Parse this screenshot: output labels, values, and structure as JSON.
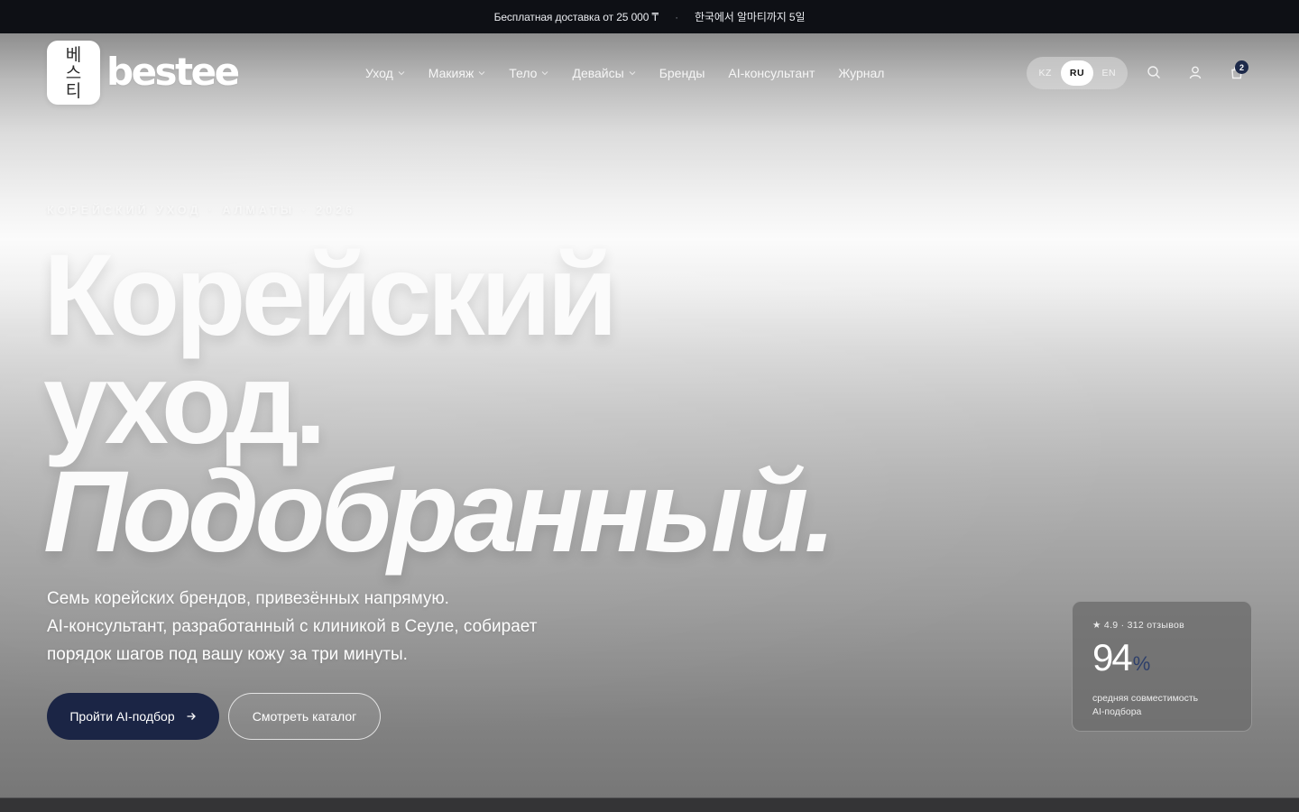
{
  "announcement": {
    "left": "Бесплатная доставка от 25 000 ₸",
    "separator": "·",
    "right": "한국에서 알마티까지 5일"
  },
  "brand": {
    "logo_mark_lines": [
      "베",
      "스",
      "티"
    ],
    "logo_word": "bestee"
  },
  "nav": {
    "items": [
      {
        "label": "Уход",
        "has_dropdown": true
      },
      {
        "label": "Макияж",
        "has_dropdown": true
      },
      {
        "label": "Тело",
        "has_dropdown": true
      },
      {
        "label": "Девайсы",
        "has_dropdown": true
      },
      {
        "label": "Бренды",
        "has_dropdown": false
      },
      {
        "label": "AI-консультант",
        "has_dropdown": false
      },
      {
        "label": "Журнал",
        "has_dropdown": false
      }
    ]
  },
  "language": {
    "options": [
      "KZ",
      "RU",
      "EN"
    ],
    "selected": "RU"
  },
  "header_icons": [
    "search-icon",
    "user-icon",
    "bag-icon"
  ],
  "cart": {
    "count": "2"
  },
  "hero": {
    "eyebrow": "Корейский уход · Алматы · 2026",
    "headline_line1": "Корейский",
    "headline_line2": "уход.",
    "headline_line3": "Подобранный.",
    "subtitle_line1": "Семь корейских брендов, привезённых напрямую.",
    "subtitle_line2": "AI-консультант, разработанный с клиникой в Сеуле, собирает",
    "subtitle_line3": "порядок шагов под вашу кожу за три минуты.",
    "primary_button": "Пройти AI-подбор",
    "secondary_button": "Смотреть каталог"
  },
  "stats_card": {
    "rating": "★ 4.9 · 312 отзывов",
    "value": "94",
    "unit": "%",
    "caption_line1": "средняя совместимость",
    "caption_line2": "AI-подбора"
  },
  "colors": {
    "topbar": "#0e1015",
    "accent_navy": "#1b2545",
    "badge": "#1d2a4a"
  }
}
